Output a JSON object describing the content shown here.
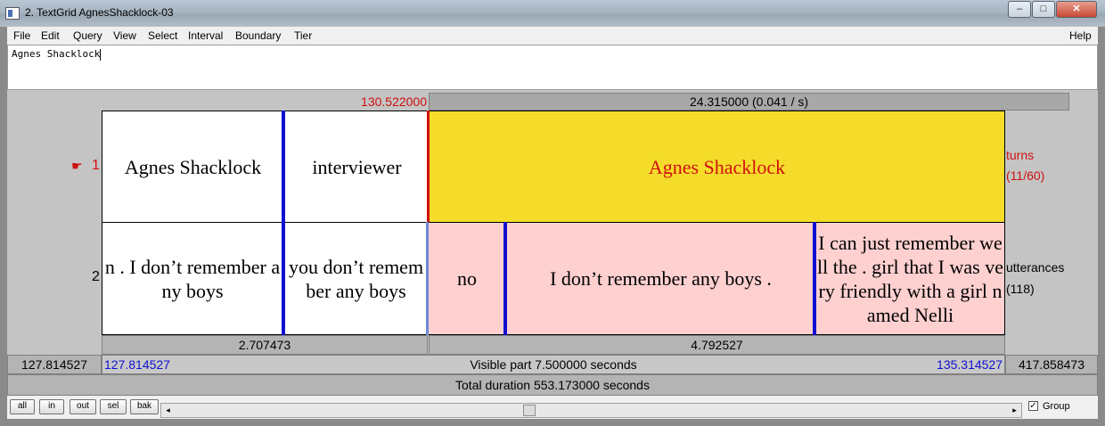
{
  "window": {
    "title": "2. TextGrid AgnesShacklock-03",
    "minimize": "–",
    "maximize": "□",
    "close": "✕"
  },
  "menu": [
    "File",
    "Edit",
    "Query",
    "View",
    "Select",
    "Interval",
    "Boundary",
    "Tier",
    "Help"
  ],
  "text_field": {
    "value": "Agnes Shacklock"
  },
  "cursor_time": "130.522000",
  "selection_duration": "24.315000 (0.041 / s)",
  "tiers": [
    {
      "number": "1",
      "pointer": "☛",
      "name": "turns",
      "count": "(11/60)",
      "intervals": [
        "Agnes Shacklock",
        "interviewer",
        "Agnes Shacklock"
      ]
    },
    {
      "number": "2",
      "name": "utterances",
      "count": "(118)",
      "intervals": [
        "n . I don’t remember any boys",
        "you don’t remember any boys",
        "no",
        "I don’t remember any boys .",
        "I can just remember well the . girl that I was very friendly with a girl named Nelli"
      ]
    }
  ],
  "durations": {
    "left": "2.707473",
    "right": "4.792527"
  },
  "visible": {
    "window_start": "127.814527",
    "start": "127.814527",
    "label": "Visible part 7.500000 seconds",
    "end": "135.314527",
    "window_end": "417.858473"
  },
  "total": "Total duration 553.173000 seconds",
  "buttons": [
    "all",
    "in",
    "out",
    "sel",
    "bak"
  ],
  "group": {
    "label": "Group",
    "checked": true
  },
  "colors": {
    "selection": "#f5dc2a",
    "interval_pink": "#ffd0d0",
    "boundary": "#1010d0",
    "cursor": "#d01010",
    "time_blue": "#1010d0"
  }
}
